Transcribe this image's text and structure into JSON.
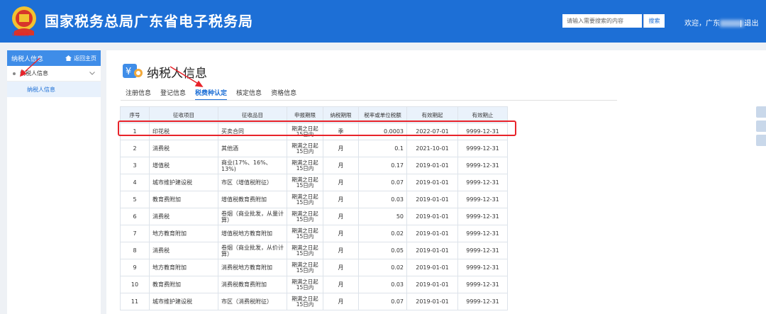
{
  "header": {
    "emblem_text": "中国税务",
    "title": "国家税务总局广东省电子税务局",
    "search_placeholder": "请输入需要搜索的内容",
    "search_button": "搜索",
    "welcome": "欢迎，广东",
    "welcome_tail": "...",
    "logout": "| 退出"
  },
  "sidebar": {
    "head_title": "纳税人信息",
    "home_link": "返回主页",
    "section_label": "纳税人信息",
    "sub_item": "纳税人信息"
  },
  "page": {
    "title": "纳税人信息",
    "tabs": [
      "注册信息",
      "登记信息",
      "税费种认定",
      "核定信息",
      "资格信息"
    ],
    "active_tab": 2
  },
  "table": {
    "columns": [
      "序号",
      "征收项目",
      "征收品目",
      "申报期限",
      "纳税期限",
      "税率或单位税额",
      "有效期起",
      "有效期止"
    ],
    "rows": [
      [
        "1",
        "印花税",
        "买卖合同",
        "期满之日起15日内",
        "季",
        "0.0003",
        "2022-07-01",
        "9999-12-31"
      ],
      [
        "2",
        "消费税",
        "其他酒",
        "期满之日起15日内",
        "月",
        "0.1",
        "2021-10-01",
        "9999-12-31"
      ],
      [
        "3",
        "增值税",
        "商业(17%、16%、13%)",
        "期满之日起15日内",
        "月",
        "0.17",
        "2019-01-01",
        "9999-12-31"
      ],
      [
        "4",
        "城市维护建设税",
        "市区（增值税附征）",
        "期满之日起15日内",
        "月",
        "0.07",
        "2019-01-01",
        "9999-12-31"
      ],
      [
        "5",
        "教育费附加",
        "增值税教育费附加",
        "期满之日起15日内",
        "月",
        "0.03",
        "2019-01-01",
        "9999-12-31"
      ],
      [
        "6",
        "消费税",
        "卷烟（商业批发，从量计算）",
        "期满之日起15日内",
        "月",
        "50",
        "2019-01-01",
        "9999-12-31"
      ],
      [
        "7",
        "地方教育附加",
        "增值税地方教育附加",
        "期满之日起15日内",
        "月",
        "0.02",
        "2019-01-01",
        "9999-12-31"
      ],
      [
        "8",
        "消费税",
        "卷烟（商业批发，从价计算）",
        "期满之日起15日内",
        "月",
        "0.05",
        "2019-01-01",
        "9999-12-31"
      ],
      [
        "9",
        "地方教育附加",
        "消费税地方教育附加",
        "期满之日起15日内",
        "月",
        "0.02",
        "2019-01-01",
        "9999-12-31"
      ],
      [
        "10",
        "教育费附加",
        "消费税教育费附加",
        "期满之日起15日内",
        "月",
        "0.03",
        "2019-01-01",
        "9999-12-31"
      ],
      [
        "11",
        "城市维护建设税",
        "市区（消费税附征）",
        "期满之日起15日内",
        "月",
        "0.07",
        "2019-01-01",
        "9999-12-31"
      ]
    ]
  },
  "colors": {
    "header_blue": "#1d6fd6",
    "highlight_red": "#e8232a"
  }
}
